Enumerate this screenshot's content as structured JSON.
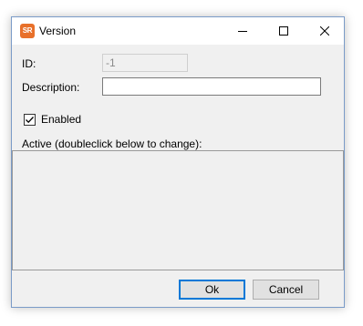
{
  "window": {
    "title": "Version",
    "app_icon_text": "SR",
    "accent_color": "#0078d7",
    "icon_color": "#e8702a"
  },
  "form": {
    "id_label": "ID:",
    "id_value": "-1",
    "description_label": "Description:",
    "description_value": "",
    "enabled_label": "Enabled",
    "enabled_checked": true,
    "active_label": "Active (doubleclick below to change):"
  },
  "buttons": {
    "ok_label": "Ok",
    "cancel_label": "Cancel"
  },
  "icons": {
    "minimize": "minimize-icon",
    "maximize": "maximize-icon",
    "close": "close-icon",
    "check": "checkmark-icon"
  }
}
